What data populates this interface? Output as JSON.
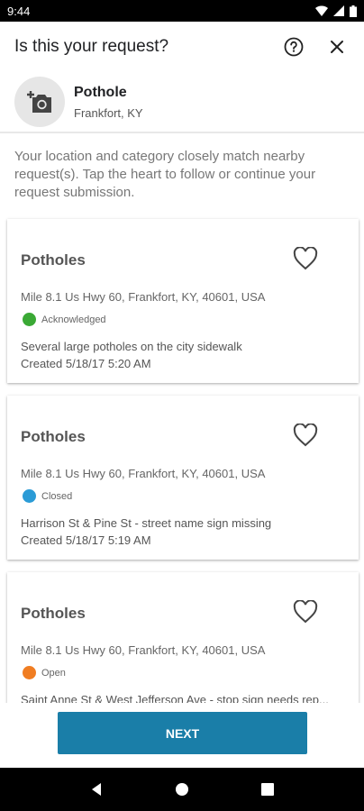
{
  "status_bar": {
    "time": "9:44"
  },
  "header": {
    "title": "Is this your request?",
    "help_icon": "help-circle-icon",
    "close_icon": "close-icon"
  },
  "request": {
    "category": "Pothole",
    "location": "Frankfort, KY",
    "icon": "add-photo-icon"
  },
  "intro_text": "Your location and category closely match nearby request(s). Tap the heart to follow or continue your request submission.",
  "cards": [
    {
      "title": "Potholes",
      "address": "Mile 8.1 Us Hwy 60, Frankfort, KY, 40601, USA",
      "status": "Acknowledged",
      "status_color": "#3aa935",
      "description": "Several large potholes on the city sidewalk",
      "created": "Created 5/18/17 5:20 AM"
    },
    {
      "title": "Potholes",
      "address": "Mile 8.1 Us Hwy 60, Frankfort, KY, 40601, USA",
      "status": "Closed",
      "status_color": "#2b9bd6",
      "description": "Harrison St & Pine St - street name sign missing",
      "created": "Created 5/18/17 5:19 AM"
    },
    {
      "title": "Potholes",
      "address": "Mile 8.1 Us Hwy 60, Frankfort, KY, 40601, USA",
      "status": "Open",
      "status_color": "#f07d22",
      "description": "Saint Anne St & West Jefferson Ave - stop sign needs rep...",
      "created": ""
    }
  ],
  "footer": {
    "next_label": "NEXT"
  },
  "colors": {
    "accent": "#1a7ea8"
  }
}
